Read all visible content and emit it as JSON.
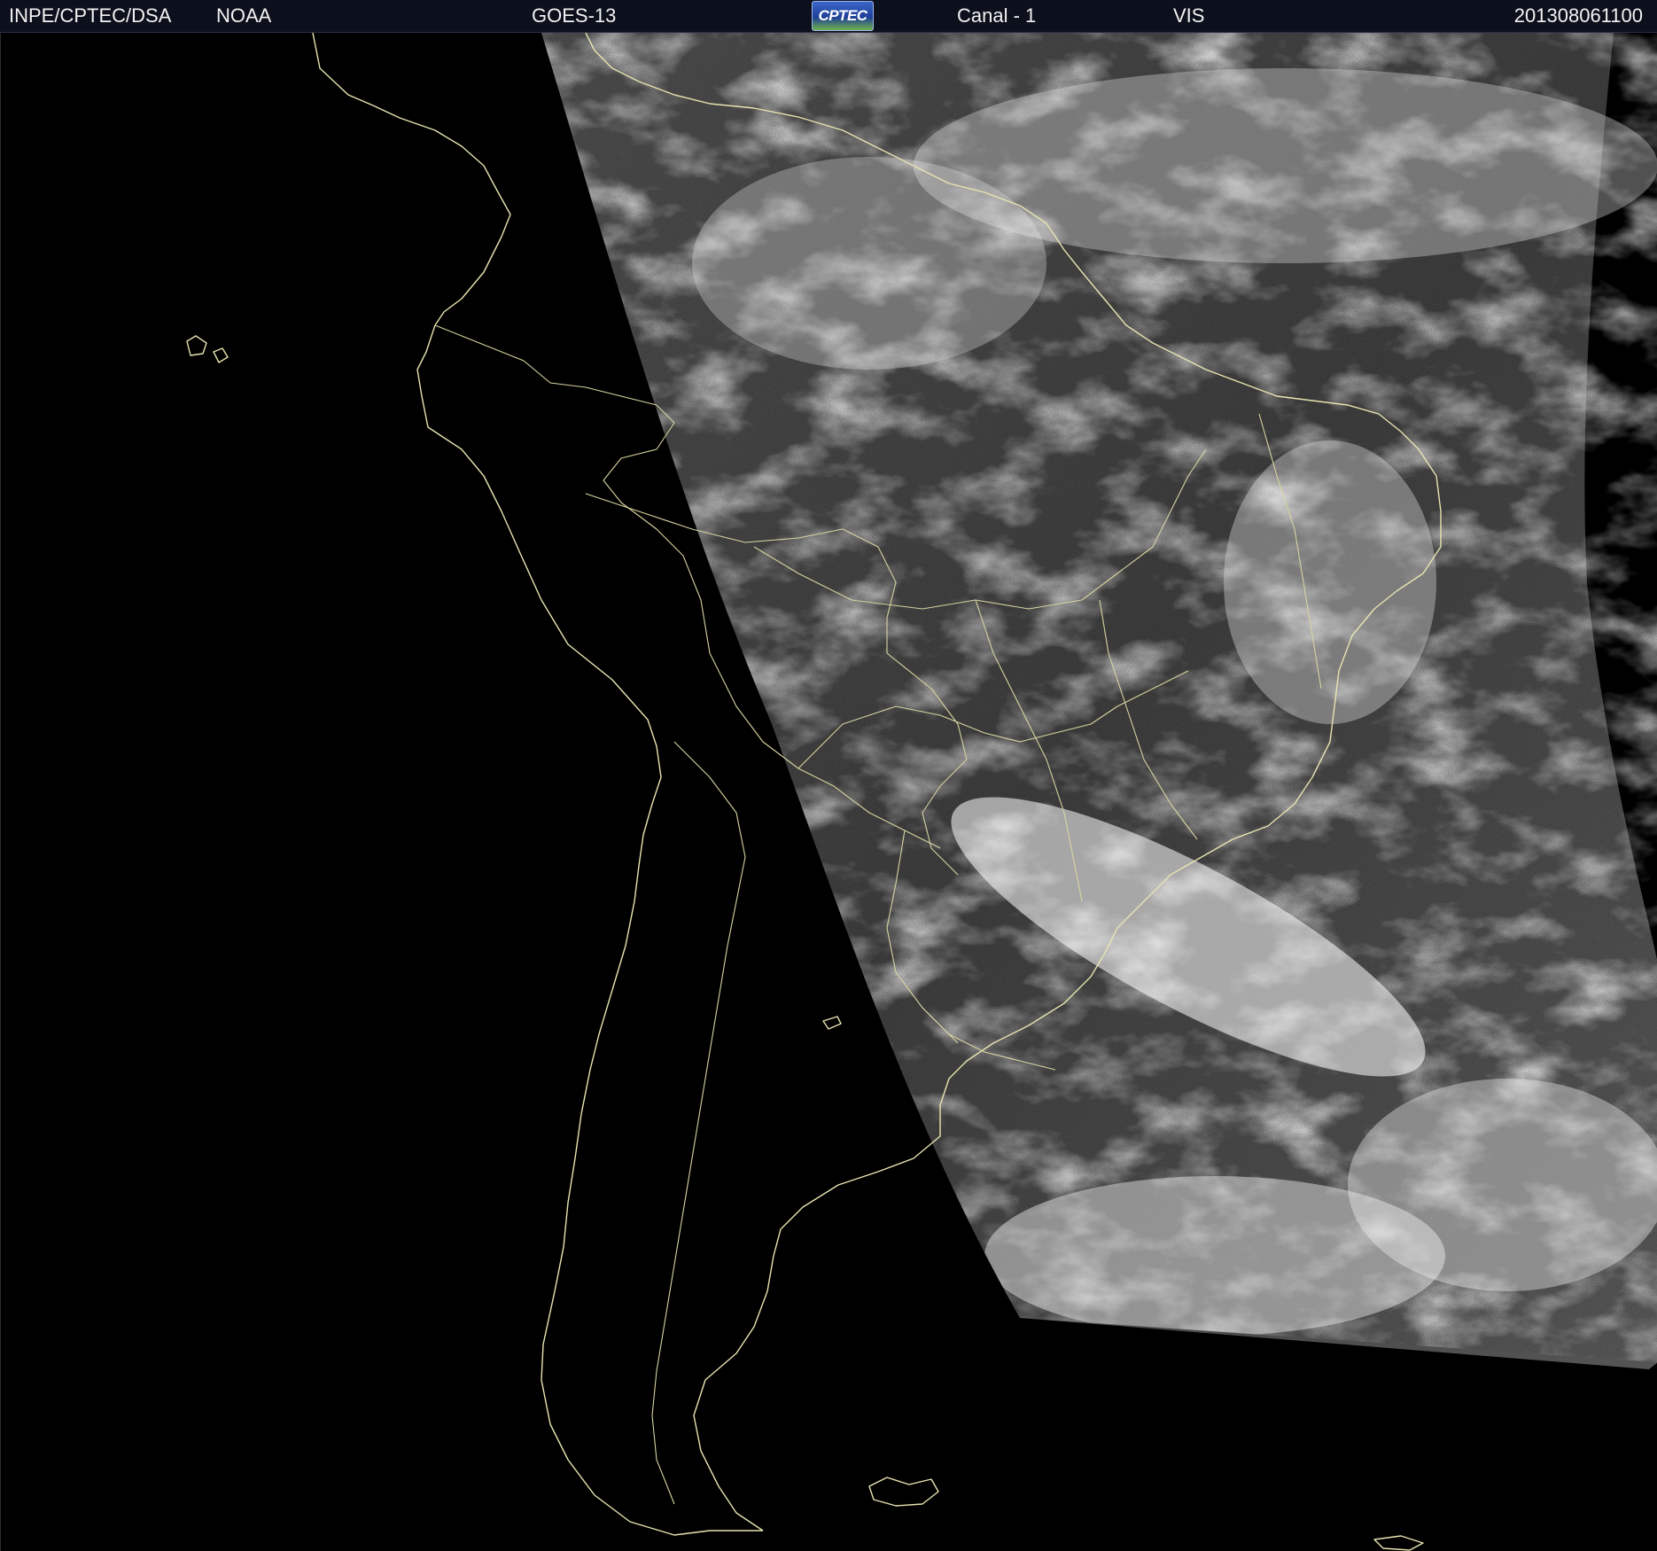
{
  "header": {
    "agency": "INPE/CPTEC/DSA",
    "source": "NOAA",
    "satellite": "GOES-13",
    "logo_text": "CPTEC",
    "channel": "Canal - 1",
    "band": "VIS",
    "timestamp": "201308061100"
  },
  "imagery": {
    "type": "visible satellite image",
    "background_color": "#000000",
    "coastline_color": "#e8e4b0",
    "cloud_color": "#f4f4f4",
    "surface_color": "#3a3a3a"
  }
}
